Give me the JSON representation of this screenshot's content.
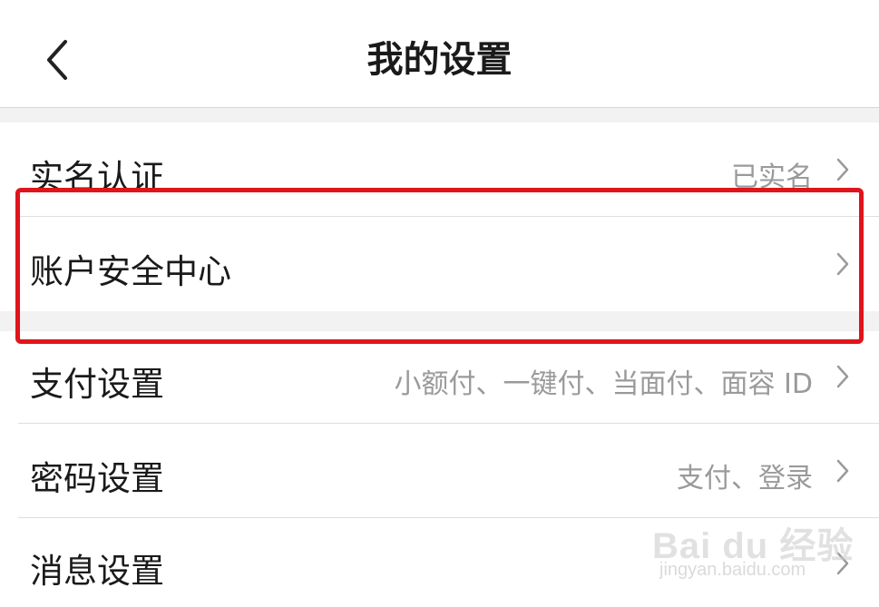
{
  "header": {
    "title": "我的设置",
    "back_icon": "chevron-left-icon"
  },
  "settings": [
    {
      "label": "实名认证",
      "value": "已实名",
      "chevron_icon": "chevron-right-icon"
    },
    {
      "label": "账户安全中心",
      "value": "",
      "chevron_icon": "chevron-right-icon"
    },
    {
      "label": "支付设置",
      "value": "小额付、一键付、当面付、面容 ID",
      "chevron_icon": "chevron-right-icon"
    },
    {
      "label": "密码设置",
      "value": "支付、登录",
      "chevron_icon": "chevron-right-icon"
    },
    {
      "label": "消息设置",
      "value": "",
      "chevron_icon": "chevron-right-icon"
    }
  ],
  "annotation": {
    "highlighted_item": "账户安全中心",
    "color": "#e0141b"
  },
  "watermark": {
    "main": "Bai du 经验",
    "sub": "jingyan.baidu.com"
  }
}
